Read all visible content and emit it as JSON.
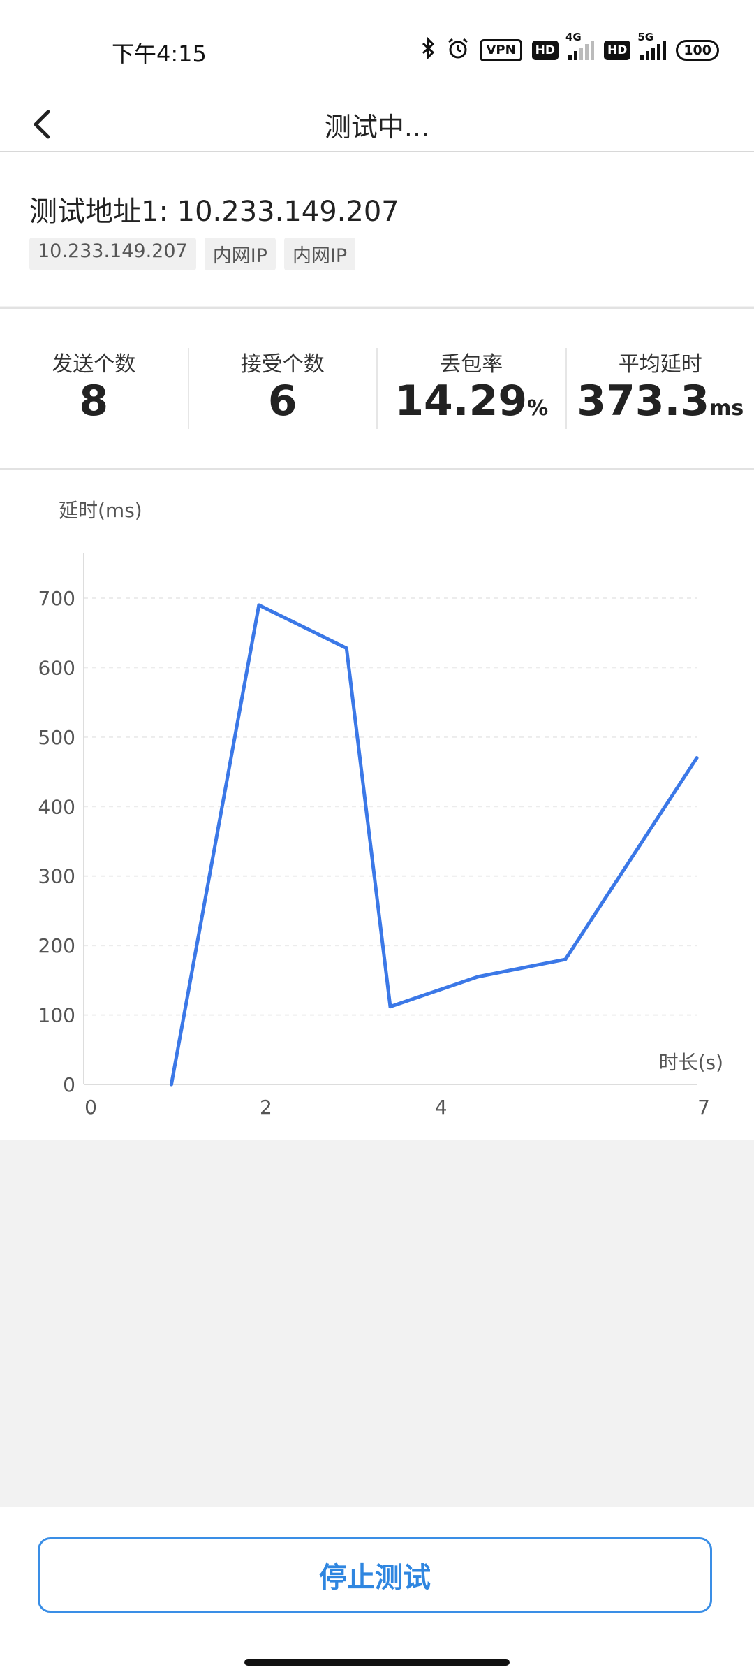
{
  "status_bar": {
    "time": "下午4:15",
    "icons": [
      "bluetooth-icon",
      "alarm-icon",
      "vpn-icon",
      "hd-icon",
      "signal-4g-icon",
      "hd-icon",
      "signal-5g-icon",
      "battery-icon"
    ],
    "vpn": "VPN",
    "hd": "HD",
    "net1": "4G",
    "net2": "5G",
    "battery": "100"
  },
  "header": {
    "title": "测试中..."
  },
  "address": {
    "title": "测试地址1: 10.233.149.207",
    "tags": [
      "10.233.149.207",
      "内网IP",
      "内网IP"
    ]
  },
  "stats": [
    {
      "label": "发送个数",
      "value": "8",
      "unit": ""
    },
    {
      "label": "接受个数",
      "value": "6",
      "unit": ""
    },
    {
      "label": "丢包率",
      "value": "14.29",
      "unit": "%"
    },
    {
      "label": "平均延时",
      "value": "373.3",
      "unit": "ms"
    }
  ],
  "chart_data": {
    "type": "line",
    "ylabel": "延时(ms)",
    "xlabel": "时长(s)",
    "ylim": [
      0,
      700
    ],
    "xlim": [
      0,
      7
    ],
    "y_ticks": [
      "0",
      "100",
      "200",
      "300",
      "400",
      "500",
      "600",
      "700"
    ],
    "x_ticks": [
      {
        "label": "0",
        "value": 0
      },
      {
        "label": "2",
        "value": 2
      },
      {
        "label": "4",
        "value": 4
      },
      {
        "label": "7",
        "value": 7
      }
    ],
    "grid": true,
    "color": "#3b78e7",
    "series": [
      {
        "x": [
          1,
          2,
          3,
          3.5,
          4.5,
          5.5,
          7
        ],
        "y": [
          0,
          690,
          628,
          112,
          155,
          180,
          470
        ]
      }
    ]
  },
  "actions": {
    "stop_label": "停止测试"
  }
}
